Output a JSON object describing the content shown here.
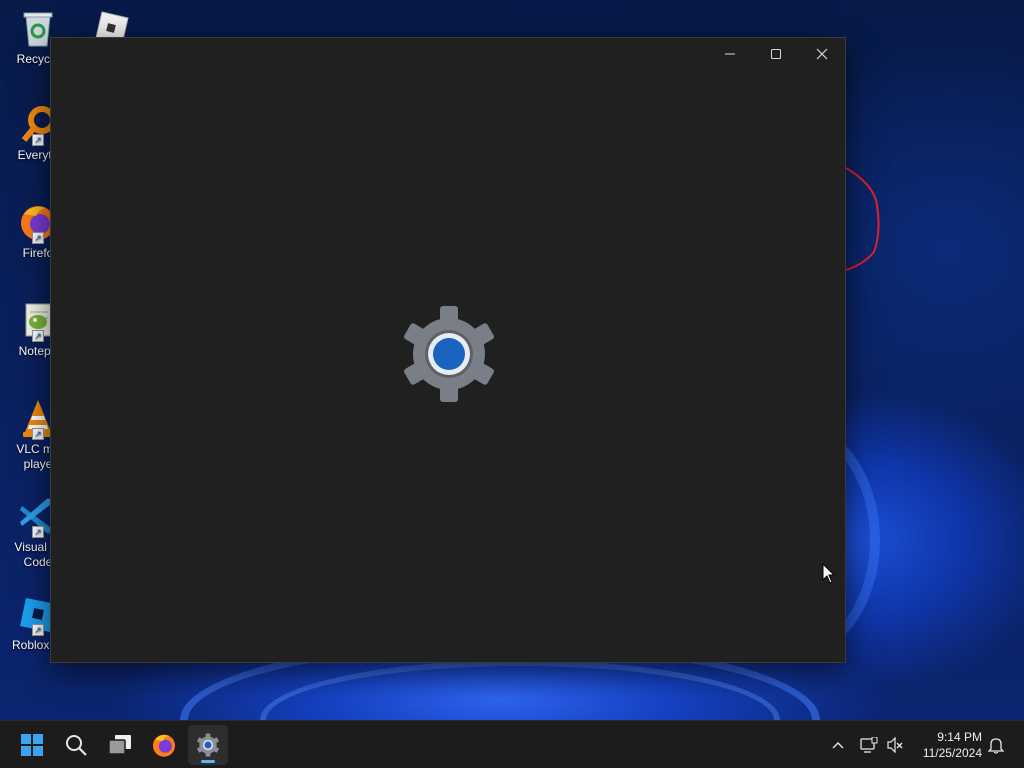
{
  "desktop": {
    "icons": [
      {
        "label": "Recycle",
        "icon": "recycle-bin-icon"
      },
      {
        "label": "Everyth",
        "icon": "everything-search-icon"
      },
      {
        "label": "Firefo",
        "icon": "firefox-icon"
      },
      {
        "label": "Notepa",
        "icon": "notepad-plus-plus-icon"
      },
      {
        "label": "VLC me",
        "label2": "playe",
        "icon": "vlc-icon"
      },
      {
        "label": "Visual St",
        "label2": "Code",
        "icon": "vscode-icon"
      },
      {
        "label": "Roblox St",
        "icon": "roblox-studio-icon"
      }
    ],
    "second_column_icon": "roblox-icon"
  },
  "window": {
    "app": "Settings",
    "state": "loading splash",
    "splash_icon": "settings-gear-icon",
    "controls": {
      "minimize": "minimize-icon",
      "maximize": "maximize-icon",
      "close": "close-icon"
    }
  },
  "taskbar": {
    "items": [
      {
        "name": "start",
        "icon": "windows-start-icon"
      },
      {
        "name": "search",
        "icon": "search-icon"
      },
      {
        "name": "task-view",
        "icon": "task-view-icon"
      },
      {
        "name": "firefox",
        "icon": "firefox-icon"
      },
      {
        "name": "settings",
        "icon": "settings-gear-icon",
        "active": true
      }
    ],
    "tray": {
      "icons": [
        "chevron-up-icon",
        "network-icon",
        "volume-muted-icon",
        "notification-bell-icon"
      ]
    },
    "clock": {
      "time": "9:14 PM",
      "date": "11/25/2024"
    }
  },
  "colors": {
    "window_bg": "#202020",
    "taskbar_bg": "#1c1c1c",
    "accent": "#5fb2f2",
    "gear_gray": "#7a7f87",
    "gear_center": "#1a64c0"
  }
}
